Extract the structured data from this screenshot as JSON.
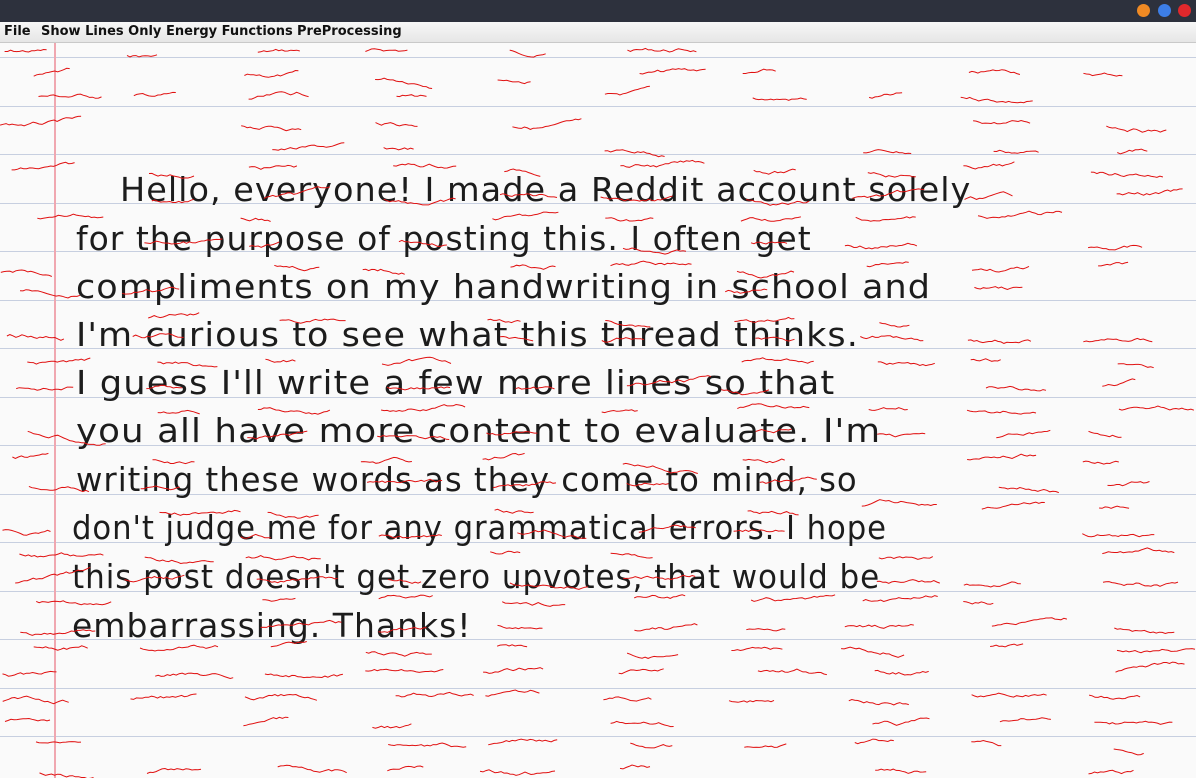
{
  "window": {
    "controls": [
      {
        "name": "minimize",
        "color": "#f08a24"
      },
      {
        "name": "maximize",
        "color": "#3d7ee6"
      },
      {
        "name": "close",
        "color": "#e0282c"
      }
    ]
  },
  "menu": {
    "file": "File",
    "show_lines_only": "Show Lines Only",
    "energy_functions": "Energy Functions",
    "preprocessing": "PreProcessing"
  },
  "note": {
    "lines": [
      "Hello, everyone! I made a Reddit account solely",
      "for the purpose of posting this. I often get",
      "compliments on my handwriting in school and",
      "I'm curious to see what this thread thinks.",
      "I guess I'll write a few more lines so that",
      "you all have more content to evaluate. I'm",
      "writing these words as they come to mind, so",
      "don't judge me for any grammatical errors. I hope",
      "this post doesn't get zero upvotes, that would be",
      "embarrassing. Thanks!"
    ]
  },
  "overlay": {
    "seam_color": "#e01010"
  }
}
